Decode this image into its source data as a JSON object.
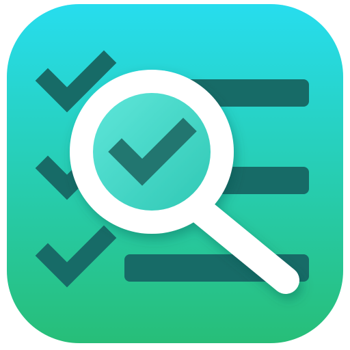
{
  "app_icon": {
    "icon_name": "checklist-search-icon",
    "colors": {
      "background_top": "#27DDEE",
      "background_bottom": "#27BE78",
      "list_items": "#176B67",
      "checkmark_in_lens": "#1F6B66",
      "lens_fill": "#3CD7C3",
      "lens_ring": "#FFFFFF"
    },
    "list_rows": [
      {
        "icon": "check-icon"
      },
      {
        "icon": "check-icon"
      },
      {
        "icon": "check-icon"
      }
    ],
    "lens": {
      "icon": "magnifier-icon",
      "inner_icon": "check-icon"
    }
  }
}
